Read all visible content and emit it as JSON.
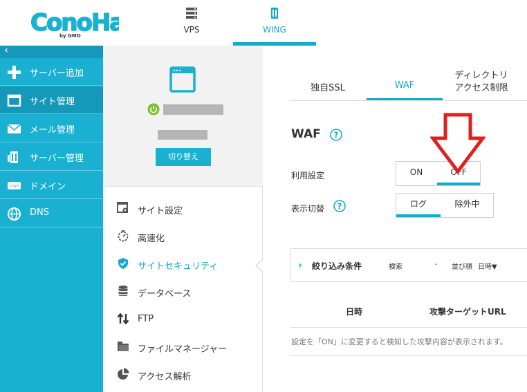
{
  "brand": {
    "logo_text": "ConoHa",
    "logo_sub": "by GMO",
    "accent": "#1ab0d2",
    "accent_dark": "#1599bb",
    "arrow_color": "#e02020"
  },
  "top_tabs": [
    {
      "label": "VPS",
      "icon": "server-icon",
      "active": false
    },
    {
      "label": "WING",
      "icon": "wing-icon",
      "active": true
    }
  ],
  "sidebar": {
    "collapse_glyph": "‹",
    "items": [
      {
        "label": "サーバー追加",
        "icon": "plus-icon"
      },
      {
        "label": "サイト管理",
        "icon": "window-icon",
        "active": true
      },
      {
        "label": "メール管理",
        "icon": "mail-icon"
      },
      {
        "label": "サーバー管理",
        "icon": "server-manage-icon"
      },
      {
        "label": "ドメイン",
        "icon": "domain-icon"
      },
      {
        "label": "DNS",
        "icon": "globe-icon"
      }
    ]
  },
  "site_card": {
    "switch_label": "切り替え"
  },
  "site_menu": [
    {
      "label": "サイト設定",
      "icon": "site-settings-icon"
    },
    {
      "label": "高速化",
      "icon": "timer-icon"
    },
    {
      "label": "サイトセキュリティ",
      "icon": "shield-icon",
      "active": true
    },
    {
      "label": "データベース",
      "icon": "database-icon"
    },
    {
      "label": "FTP",
      "icon": "transfer-icon"
    },
    {
      "label": "ファイルマネージャー",
      "icon": "folder-icon"
    },
    {
      "label": "アクセス解析",
      "icon": "pie-chart-icon"
    }
  ],
  "content": {
    "subtabs": [
      {
        "label": "独自SSL"
      },
      {
        "label": "WAF",
        "active": true
      },
      {
        "label_line1": "ディレクトリ",
        "label_line2": "アクセス制限"
      }
    ],
    "title": "WAF",
    "usage_setting": {
      "label": "利用設定",
      "options": [
        "ON",
        "OFF"
      ],
      "selected": "OFF"
    },
    "display_switch": {
      "label": "表示切替",
      "options": [
        "ログ",
        "除外中"
      ],
      "selected": "ログ"
    },
    "filter": {
      "label": "絞り込み条件",
      "search_label": "検索",
      "search_value": "-",
      "sort_label": "並び順",
      "sort_value": "日時▼"
    },
    "table": {
      "headers": [
        "日時",
        "攻撃ターゲットURL"
      ],
      "empty_message": "設定を「ON」に変更すると検知した攻撃内容が表示されます。"
    }
  }
}
